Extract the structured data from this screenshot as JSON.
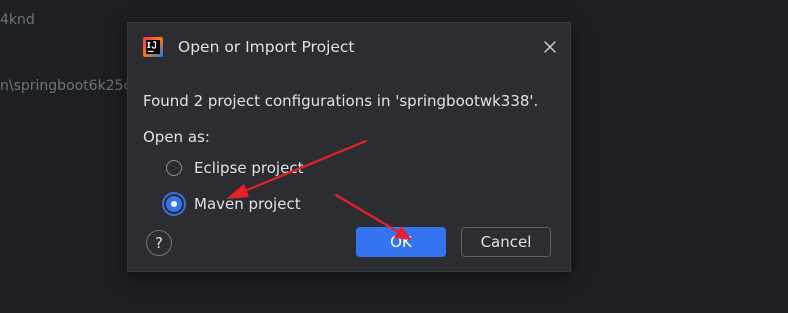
{
  "background": {
    "text_line_1": "4knd",
    "text_line_2": "n\\springboot6k25c"
  },
  "dialog": {
    "title": "Open or Import Project",
    "app_icon": "intellij-idea-logo-icon",
    "close_icon": "close-icon",
    "message": "Found 2 project configurations in 'springbootwk338'.",
    "open_as_label": "Open as:",
    "options": [
      {
        "label": "Eclipse project",
        "selected": false
      },
      {
        "label": "Maven project",
        "selected": true
      }
    ],
    "help_label": "?",
    "ok_label": "OK",
    "cancel_label": "Cancel"
  },
  "colors": {
    "background": "#1e1f22",
    "dialog": "#2b2d30",
    "accent": "#3574f0",
    "annotation_arrow": "#e8202a"
  }
}
